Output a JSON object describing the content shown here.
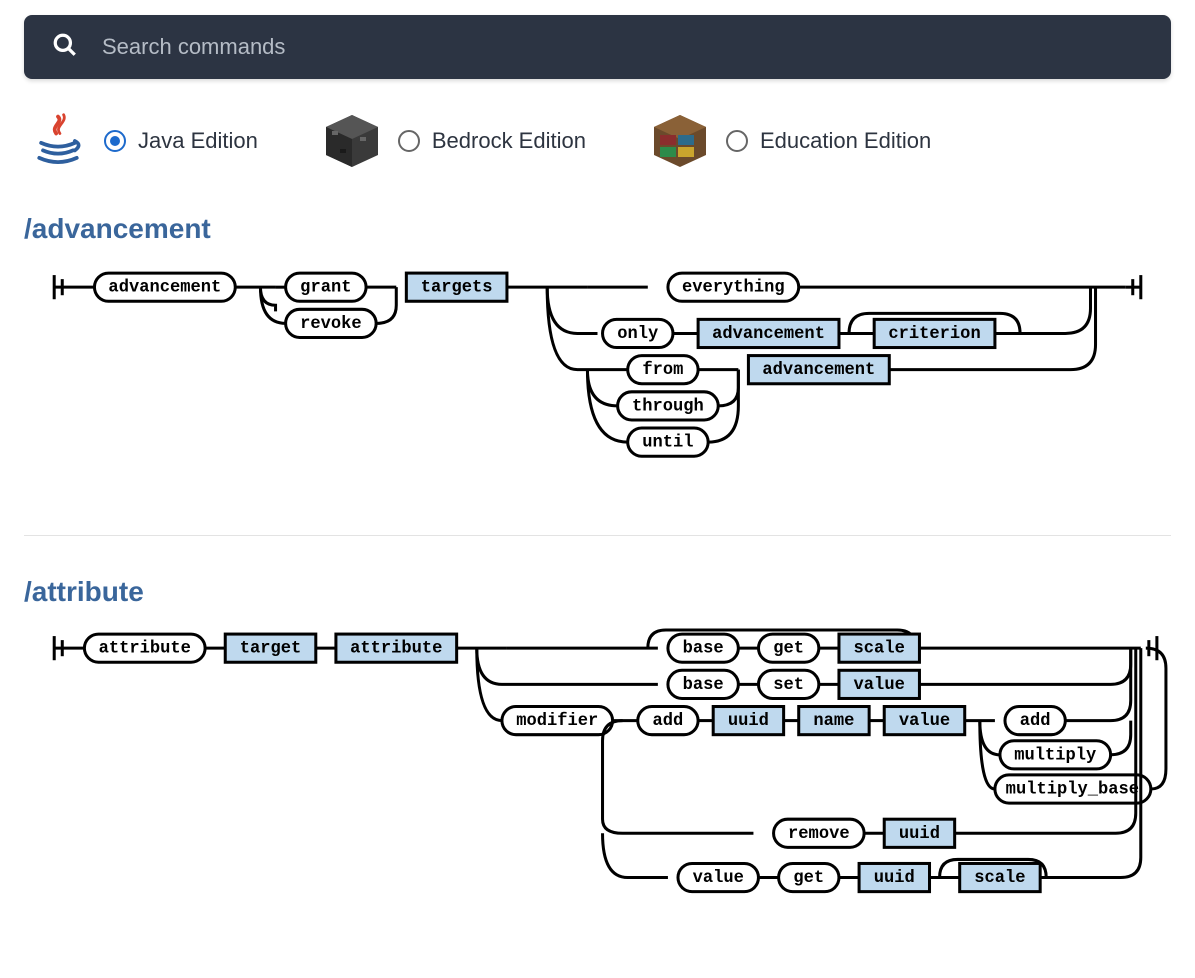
{
  "search": {
    "placeholder": "Search commands"
  },
  "editions": [
    {
      "id": "java",
      "label": "Java Edition",
      "selected": true
    },
    {
      "id": "bedrock",
      "label": "Bedrock Edition",
      "selected": false
    },
    {
      "id": "education",
      "label": "Education Edition",
      "selected": false
    }
  ],
  "commands": {
    "advancement": {
      "title": "/advancement",
      "nodes": {
        "root": "advancement",
        "grant": "grant",
        "revoke": "revoke",
        "targets": "targets",
        "everything": "everything",
        "only": "only",
        "adv1": "advancement",
        "criterion": "criterion",
        "from": "from",
        "through": "through",
        "until": "until",
        "adv2": "advancement"
      }
    },
    "attribute": {
      "title": "/attribute",
      "nodes": {
        "root": "attribute",
        "target": "target",
        "attribute": "attribute",
        "base1": "base",
        "base2": "base",
        "get1": "get",
        "set1": "set",
        "scale1": "scale",
        "value1": "value",
        "modifier": "modifier",
        "add": "add",
        "uuid1": "uuid",
        "name": "name",
        "value2": "value",
        "add2": "add",
        "multiply": "multiply",
        "multiply_base": "multiply_base",
        "remove": "remove",
        "uuid2": "uuid",
        "valuelit": "value",
        "get2": "get",
        "uuid3": "uuid",
        "scale2": "scale"
      }
    }
  }
}
